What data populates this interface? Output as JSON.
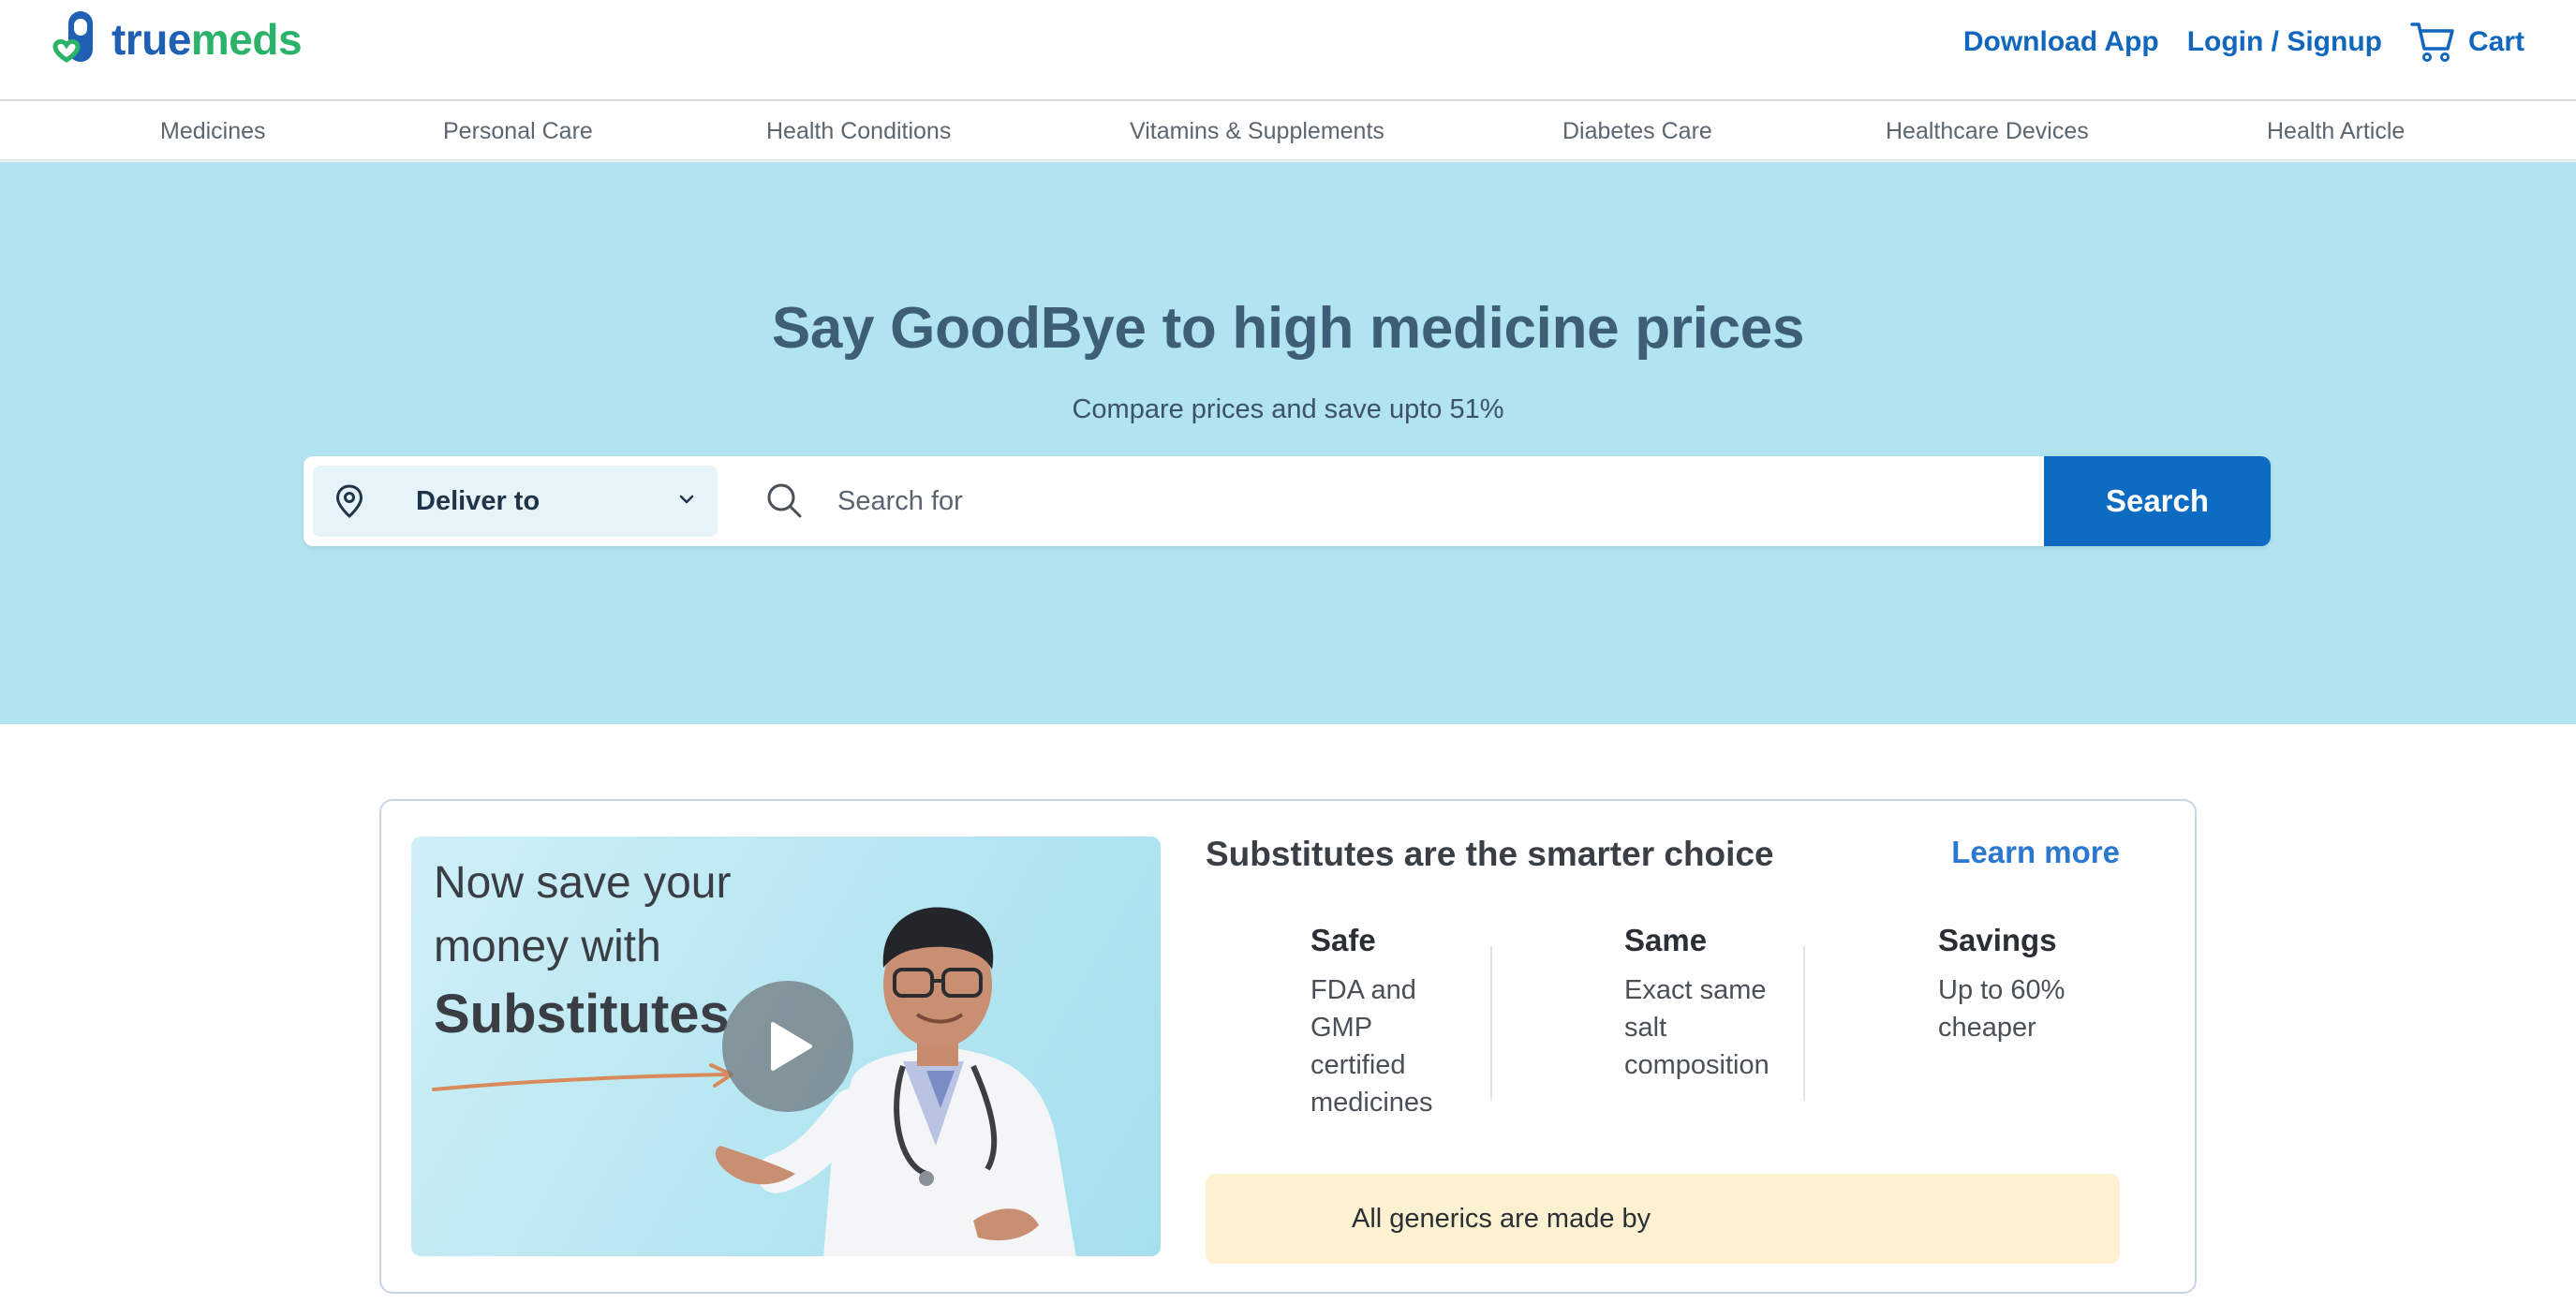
{
  "brand": {
    "part1": "true",
    "part2": "meds",
    "icon": "pill-heart-logo-icon",
    "colors": {
      "blue": "#1f5fb4",
      "green": "#2bb36a"
    }
  },
  "header": {
    "download_app": "Download App",
    "login": "Login / Signup",
    "cart": "Cart",
    "cart_icon": "cart-icon",
    "link_color": "#1167bd"
  },
  "nav": {
    "items": [
      "Medicines",
      "Personal Care",
      "Health Conditions",
      "Vitamins & Supplements",
      "Diabetes Care",
      "Healthcare Devices",
      "Health Article"
    ]
  },
  "hero": {
    "title": "Say GoodBye to high medicine prices",
    "subtitle": "Compare prices and save upto 51%",
    "background": "#b1e3f0",
    "deliver_label": "Deliver to",
    "deliver_icons": [
      "location-pin-icon",
      "chevron-down-icon"
    ],
    "search_placeholder": "Search for",
    "search_icon": "search-icon",
    "search_button": "Search",
    "search_button_color": "#0d6cc1"
  },
  "substitutes": {
    "title": "Substitutes are the smarter choice",
    "learn_more": "Learn more",
    "video": {
      "line1": "Now save your",
      "line2": "money with",
      "line3": "Substitutes",
      "play_icon": "play-icon"
    },
    "features": [
      {
        "title": "Safe",
        "desc": "FDA and GMP certified medicines"
      },
      {
        "title": "Same",
        "desc": "Exact same salt composition"
      },
      {
        "title": "Savings",
        "desc": "Up to 60% cheaper"
      }
    ],
    "generics_text": "All generics are made by",
    "generics_bg": "#fef1d2"
  }
}
